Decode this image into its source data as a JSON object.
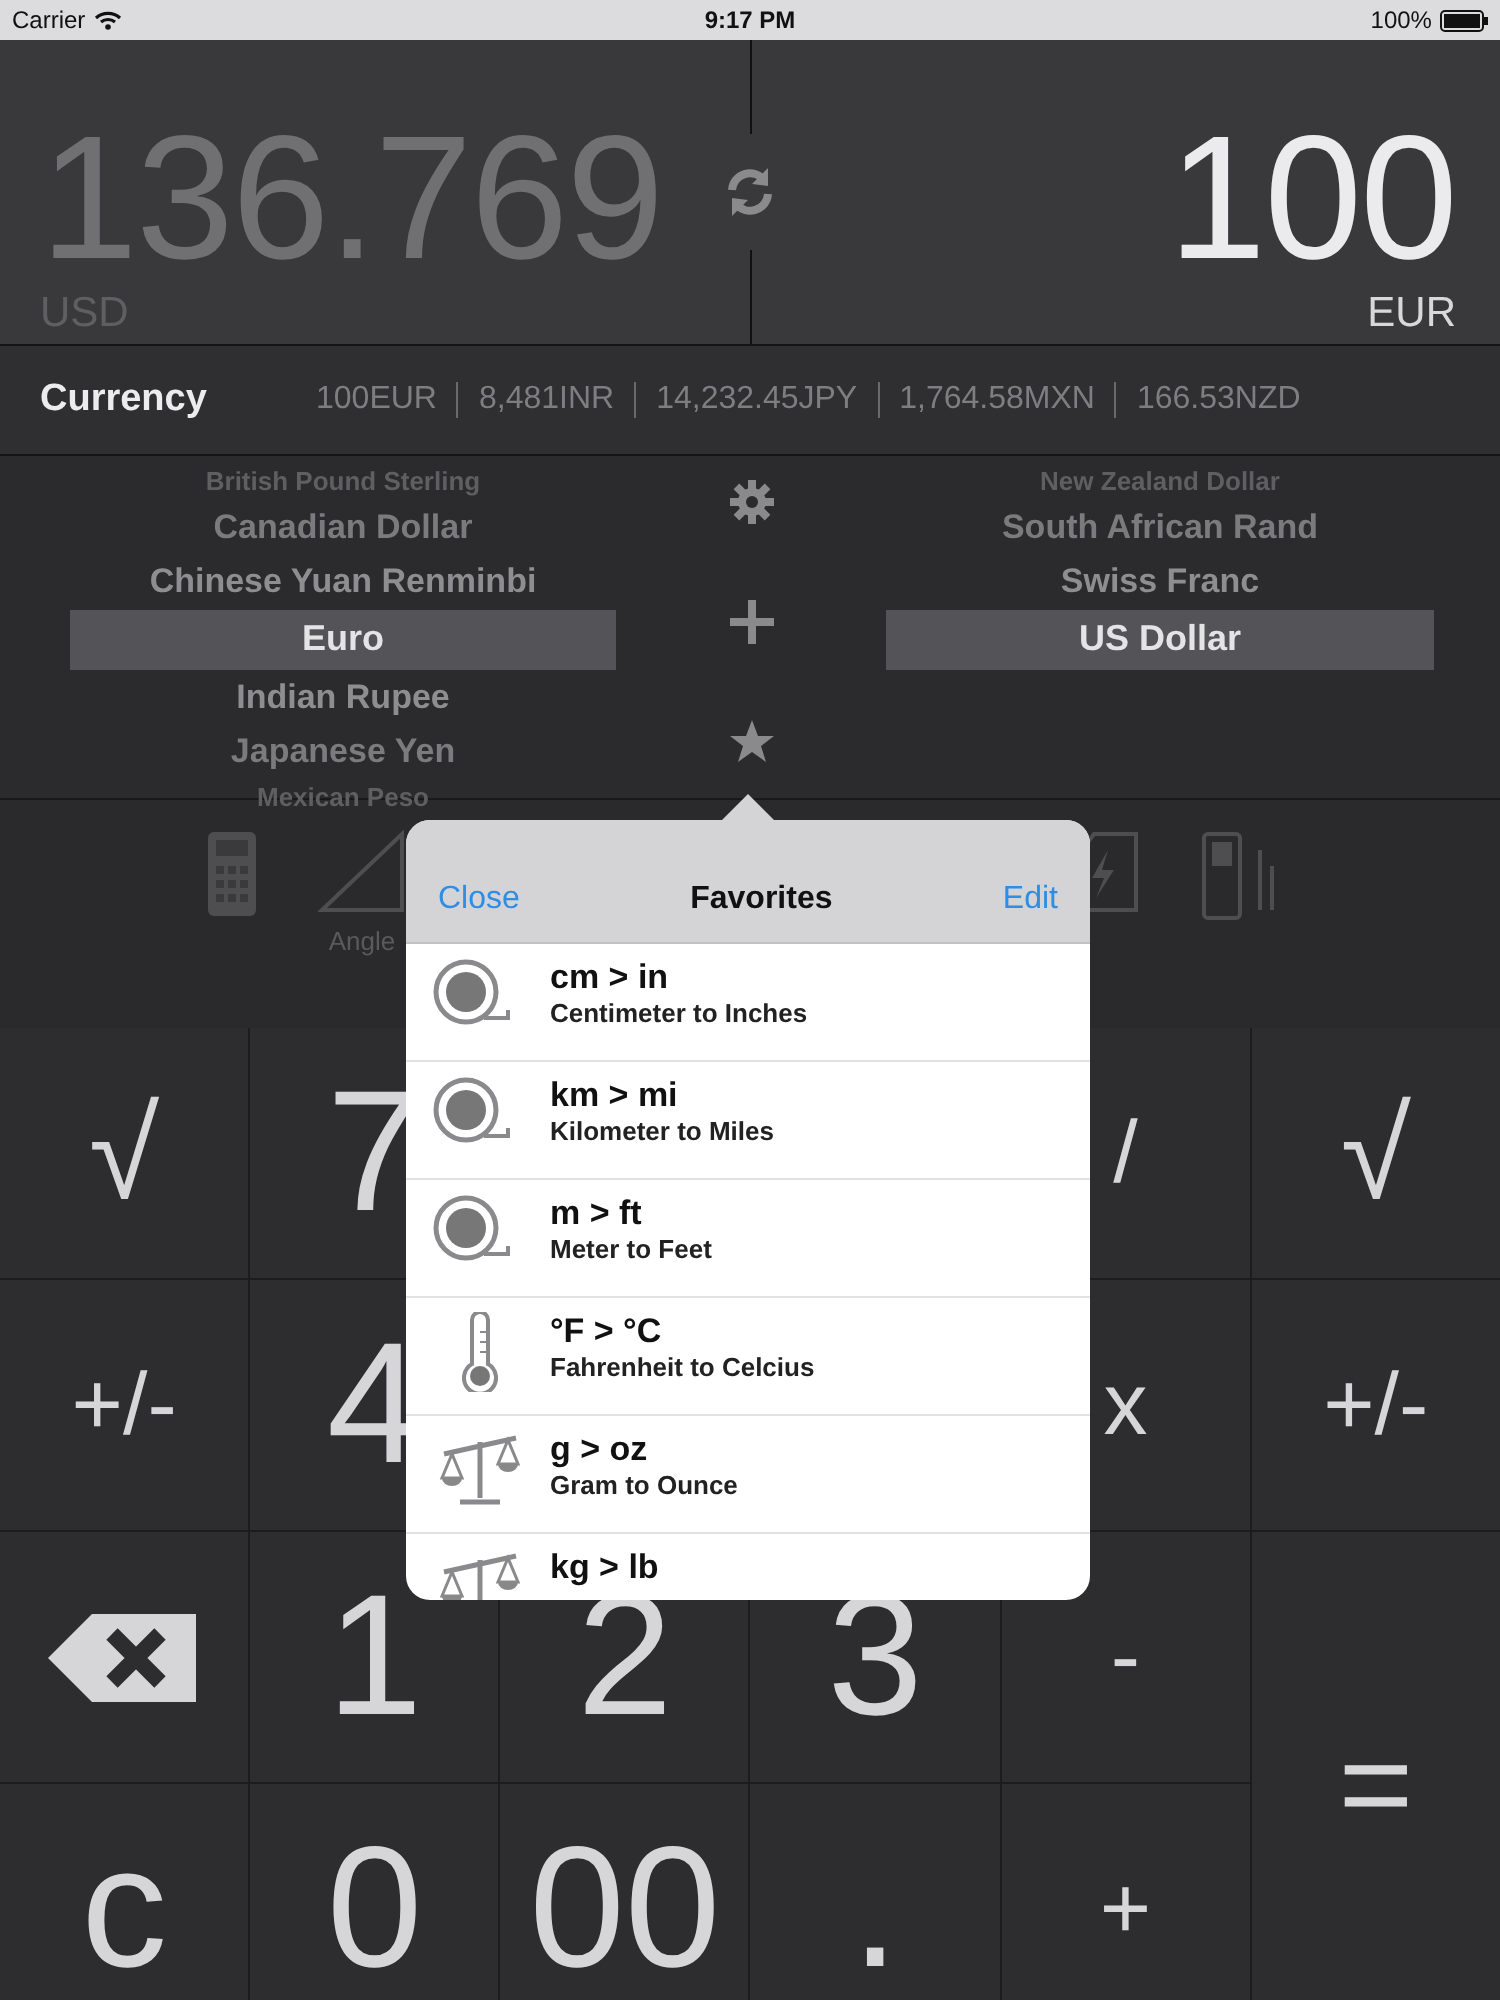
{
  "status_bar": {
    "carrier": "Carrier",
    "time": "9:17 PM",
    "battery": "100%"
  },
  "display": {
    "left": {
      "value": "136.769",
      "unit": "USD",
      "active": false
    },
    "right": {
      "value": "100",
      "unit": "EUR",
      "active": true
    }
  },
  "rates_bar": {
    "category": "Currency",
    "rates": [
      "100EUR",
      "8,481INR",
      "14,232.45JPY",
      "1,764.58MXN",
      "166.53NZD"
    ]
  },
  "picker": {
    "left": [
      {
        "label": "British Pound Sterling",
        "selected": false
      },
      {
        "label": "Canadian Dollar",
        "selected": false
      },
      {
        "label": "Chinese Yuan Renminbi",
        "selected": false
      },
      {
        "label": "Euro",
        "selected": true
      },
      {
        "label": "Indian Rupee",
        "selected": false
      },
      {
        "label": "Japanese Yen",
        "selected": false
      },
      {
        "label": "Mexican Peso",
        "selected": false
      }
    ],
    "right": [
      {
        "label": "New Zealand Dollar",
        "selected": false
      },
      {
        "label": "South African Rand",
        "selected": false
      },
      {
        "label": "Swiss Franc",
        "selected": false
      },
      {
        "label": "US Dollar",
        "selected": true
      }
    ]
  },
  "toolbar": [
    {
      "kind": "calculator"
    },
    {
      "kind": "angle",
      "label": "Angle"
    },
    {
      "kind": "flash"
    },
    {
      "kind": "device"
    }
  ],
  "keypad": [
    {
      "left": [
        {
          "kind": "sqrt",
          "label": "√"
        },
        {
          "kind": "digit",
          "label": "7"
        }
      ],
      "right": [
        {
          "kind": "op",
          "label": "/"
        },
        {
          "kind": "sqrt",
          "label": "√"
        }
      ]
    },
    {
      "left": [
        {
          "kind": "op",
          "label": "+/-"
        },
        {
          "kind": "digit",
          "label": "4"
        }
      ],
      "right": [
        {
          "kind": "op",
          "label": "x"
        },
        {
          "kind": "op",
          "label": "+/-"
        }
      ]
    },
    {
      "left": [
        {
          "kind": "backspace"
        },
        {
          "kind": "digit",
          "label": "1"
        },
        {
          "kind": "digit",
          "label": "2"
        },
        {
          "kind": "digit",
          "label": "3"
        },
        {
          "kind": "op",
          "label": "-"
        }
      ],
      "right": [
        {
          "kind": "equals",
          "label": "="
        }
      ]
    },
    {
      "left": [
        {
          "kind": "digit",
          "label": "c"
        },
        {
          "kind": "digit",
          "label": "0"
        },
        {
          "kind": "digit",
          "label": "00"
        },
        {
          "kind": "digit",
          "label": "."
        },
        {
          "kind": "op",
          "label": "+"
        }
      ]
    }
  ],
  "popover": {
    "title": "Favorites",
    "left_button": "Close",
    "right_button": "Edit",
    "items": [
      {
        "kind": "tape",
        "title": "cm > in",
        "subtitle": "Centimeter to Inches"
      },
      {
        "kind": "tape",
        "title": "km > mi",
        "subtitle": "Kilometer to Miles"
      },
      {
        "kind": "tape",
        "title": "m > ft",
        "subtitle": "Meter to Feet"
      },
      {
        "kind": "thermometer",
        "title": "°F > °C",
        "subtitle": "Fahrenheit to Celcius"
      },
      {
        "kind": "scale",
        "title": "g > oz",
        "subtitle": "Gram to Ounce"
      },
      {
        "kind": "scale",
        "title": "kg > lb"
      }
    ]
  }
}
